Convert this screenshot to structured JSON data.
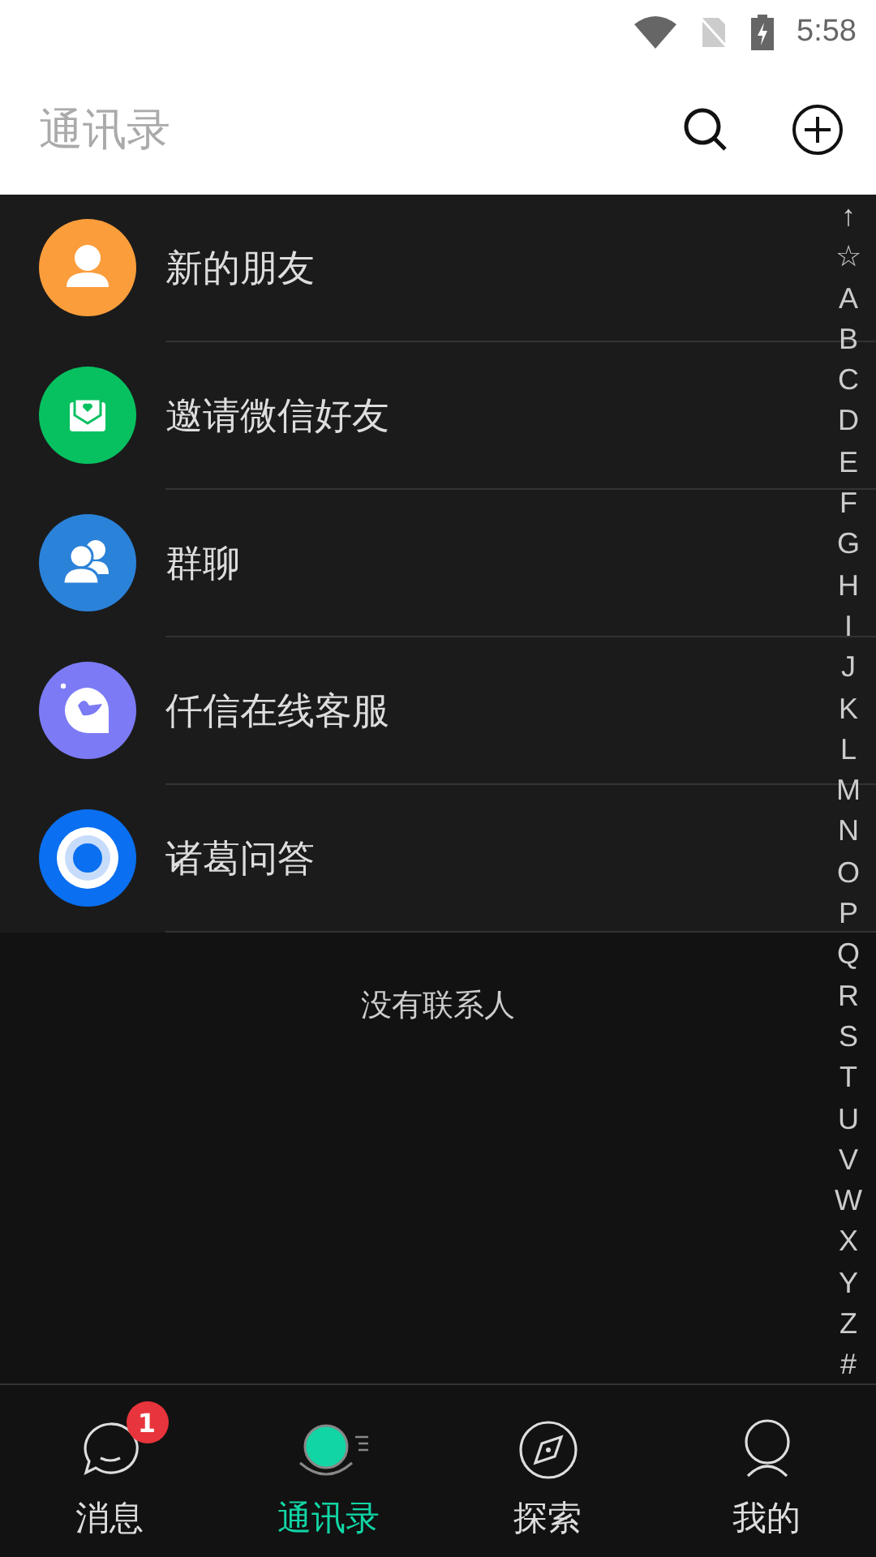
{
  "status_bar": {
    "time": "5:58"
  },
  "header": {
    "title": "通讯录"
  },
  "entries": [
    {
      "label": "新的朋友",
      "kind": "person",
      "color": "#fb9d3b"
    },
    {
      "label": "邀请微信好友",
      "kind": "invite",
      "color": "#07c160"
    },
    {
      "label": "群聊",
      "kind": "group",
      "color": "#2b82d9"
    },
    {
      "label": "仟信在线客服",
      "kind": "service",
      "color": "#7c7bf5"
    },
    {
      "label": "诸葛问答",
      "kind": "ring",
      "color": "#0a6ff0"
    }
  ],
  "empty_text": "没有联系人",
  "index": [
    "↑",
    "☆",
    "A",
    "B",
    "C",
    "D",
    "E",
    "F",
    "G",
    "H",
    "I",
    "J",
    "K",
    "L",
    "M",
    "N",
    "O",
    "P",
    "Q",
    "R",
    "S",
    "T",
    "U",
    "V",
    "W",
    "X",
    "Y",
    "Z",
    "#"
  ],
  "tabs": [
    {
      "label": "消息",
      "kind": "chat",
      "selected": false,
      "badge": "1"
    },
    {
      "label": "通讯录",
      "kind": "contacts",
      "selected": true
    },
    {
      "label": "探索",
      "kind": "compass",
      "selected": false
    },
    {
      "label": "我的",
      "kind": "me",
      "selected": false
    }
  ]
}
